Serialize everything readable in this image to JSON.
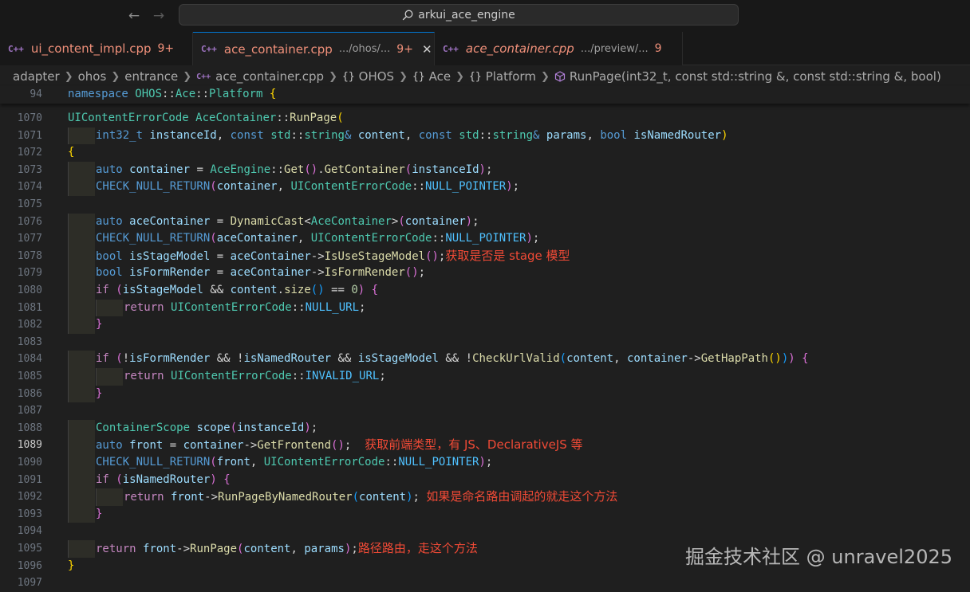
{
  "titlebar": {
    "back_icon": "arrow-left-icon",
    "forward_icon": "arrow-right-icon",
    "search_text": "arkui_ace_engine"
  },
  "tabs": [
    {
      "icon": "C++",
      "name": "ui_content_impl.cpp",
      "path": "",
      "badge": "9+",
      "active": false,
      "italic": false,
      "close": ""
    },
    {
      "icon": "C++",
      "name": "ace_container.cpp",
      "path": ".../ohos/...",
      "badge": "9+",
      "active": true,
      "italic": false,
      "close": "✕"
    },
    {
      "icon": "C++",
      "name": "ace_container.cpp",
      "path": ".../preview/...",
      "badge": "9",
      "active": false,
      "italic": true,
      "close": ""
    }
  ],
  "breadcrumb": {
    "folders": [
      "adapter",
      "ohos",
      "entrance"
    ],
    "file": "ace_container.cpp",
    "symbols": [
      "OHOS",
      "Ace",
      "Platform"
    ],
    "method": "RunPage(int32_t, const std::string &, const std::string &, bool)"
  },
  "editor": {
    "current_line": "1089",
    "lines": [
      {
        "n": "94",
        "sticky": true,
        "indent": 0,
        "t": [
          [
            "kw",
            "namespace "
          ],
          [
            "type",
            "OHOS"
          ],
          [
            "p",
            "::"
          ],
          [
            "type",
            "Ace"
          ],
          [
            "p",
            "::"
          ],
          [
            "type",
            "Platform"
          ],
          [
            "p",
            " "
          ],
          [
            "b1",
            "{"
          ]
        ]
      },
      {
        "n": "1070",
        "indent": 0,
        "t": [
          [
            "type",
            "UIContentErrorCode"
          ],
          [
            "p",
            " "
          ],
          [
            "type",
            "AceContainer"
          ],
          [
            "p",
            "::"
          ],
          [
            "fn",
            "RunPage"
          ],
          [
            "b1",
            "("
          ]
        ]
      },
      {
        "n": "1071",
        "indent": 1,
        "t": [
          [
            "kw",
            "int32_t"
          ],
          [
            "p",
            " "
          ],
          [
            "var",
            "instanceId"
          ],
          [
            "p",
            ", "
          ],
          [
            "kw",
            "const"
          ],
          [
            "p",
            " "
          ],
          [
            "type",
            "std"
          ],
          [
            "p",
            "::"
          ],
          [
            "type",
            "string"
          ],
          [
            "kw",
            "&"
          ],
          [
            "p",
            " "
          ],
          [
            "var",
            "content"
          ],
          [
            "p",
            ", "
          ],
          [
            "kw",
            "const"
          ],
          [
            "p",
            " "
          ],
          [
            "type",
            "std"
          ],
          [
            "p",
            "::"
          ],
          [
            "type",
            "string"
          ],
          [
            "kw",
            "&"
          ],
          [
            "p",
            " "
          ],
          [
            "var",
            "params"
          ],
          [
            "p",
            ", "
          ],
          [
            "kw",
            "bool"
          ],
          [
            "p",
            " "
          ],
          [
            "var",
            "isNamedRouter"
          ],
          [
            "b1",
            ")"
          ]
        ]
      },
      {
        "n": "1072",
        "indent": 0,
        "t": [
          [
            "b1",
            "{"
          ]
        ]
      },
      {
        "n": "1073",
        "indent": 1,
        "t": [
          [
            "kw",
            "auto"
          ],
          [
            "p",
            " "
          ],
          [
            "var",
            "container"
          ],
          [
            "p",
            " = "
          ],
          [
            "type",
            "AceEngine"
          ],
          [
            "p",
            "::"
          ],
          [
            "fn",
            "Get"
          ],
          [
            "b2",
            "()"
          ],
          [
            "p",
            "."
          ],
          [
            "fn",
            "GetContainer"
          ],
          [
            "b2",
            "("
          ],
          [
            "var",
            "instanceId"
          ],
          [
            "b2",
            ")"
          ],
          [
            "p",
            ";"
          ]
        ]
      },
      {
        "n": "1074",
        "indent": 1,
        "t": [
          [
            "macro",
            "CHECK_NULL_RETURN"
          ],
          [
            "b2",
            "("
          ],
          [
            "var",
            "container"
          ],
          [
            "p",
            ", "
          ],
          [
            "type",
            "UIContentErrorCode"
          ],
          [
            "p",
            "::"
          ],
          [
            "const",
            "NULL_POINTER"
          ],
          [
            "b2",
            ")"
          ],
          [
            "p",
            ";"
          ]
        ]
      },
      {
        "n": "1075",
        "indent": 0,
        "t": []
      },
      {
        "n": "1076",
        "indent": 1,
        "t": [
          [
            "kw",
            "auto"
          ],
          [
            "p",
            " "
          ],
          [
            "var",
            "aceContainer"
          ],
          [
            "p",
            " = "
          ],
          [
            "fn",
            "DynamicCast"
          ],
          [
            "p",
            "<"
          ],
          [
            "type",
            "AceContainer"
          ],
          [
            "p",
            ">"
          ],
          [
            "b2",
            "("
          ],
          [
            "var",
            "container"
          ],
          [
            "b2",
            ")"
          ],
          [
            "p",
            ";"
          ]
        ]
      },
      {
        "n": "1077",
        "indent": 1,
        "t": [
          [
            "macro",
            "CHECK_NULL_RETURN"
          ],
          [
            "b2",
            "("
          ],
          [
            "var",
            "aceContainer"
          ],
          [
            "p",
            ", "
          ],
          [
            "type",
            "UIContentErrorCode"
          ],
          [
            "p",
            "::"
          ],
          [
            "const",
            "NULL_POINTER"
          ],
          [
            "b2",
            ")"
          ],
          [
            "p",
            ";"
          ]
        ]
      },
      {
        "n": "1078",
        "indent": 1,
        "t": [
          [
            "kw",
            "bool"
          ],
          [
            "p",
            " "
          ],
          [
            "var",
            "isStageModel"
          ],
          [
            "p",
            " = "
          ],
          [
            "var",
            "aceContainer"
          ],
          [
            "p",
            "->"
          ],
          [
            "fn",
            "IsUseStageModel"
          ],
          [
            "b2",
            "()"
          ],
          [
            "p",
            ";"
          ]
        ],
        "note": "获取是否是 stage 模型",
        "note_gap": ""
      },
      {
        "n": "1079",
        "indent": 1,
        "t": [
          [
            "kw",
            "bool"
          ],
          [
            "p",
            " "
          ],
          [
            "var",
            "isFormRender"
          ],
          [
            "p",
            " = "
          ],
          [
            "var",
            "aceContainer"
          ],
          [
            "p",
            "->"
          ],
          [
            "fn",
            "IsFormRender"
          ],
          [
            "b2",
            "()"
          ],
          [
            "p",
            ";"
          ]
        ]
      },
      {
        "n": "1080",
        "indent": 1,
        "t": [
          [
            "ctrl",
            "if"
          ],
          [
            "p",
            " "
          ],
          [
            "b2",
            "("
          ],
          [
            "var",
            "isStageModel"
          ],
          [
            "p",
            " && "
          ],
          [
            "var",
            "content"
          ],
          [
            "p",
            "."
          ],
          [
            "fn",
            "size"
          ],
          [
            "b3",
            "()"
          ],
          [
            "p",
            " == "
          ],
          [
            "num",
            "0"
          ],
          [
            "b2",
            ")"
          ],
          [
            "p",
            " "
          ],
          [
            "b2",
            "{"
          ]
        ]
      },
      {
        "n": "1081",
        "indent": 2,
        "t": [
          [
            "ctrl",
            "return"
          ],
          [
            "p",
            " "
          ],
          [
            "type",
            "UIContentErrorCode"
          ],
          [
            "p",
            "::"
          ],
          [
            "const",
            "NULL_URL"
          ],
          [
            "p",
            ";"
          ]
        ]
      },
      {
        "n": "1082",
        "indent": 1,
        "t": [
          [
            "b2",
            "}"
          ]
        ]
      },
      {
        "n": "1083",
        "indent": 0,
        "t": []
      },
      {
        "n": "1084",
        "indent": 1,
        "t": [
          [
            "ctrl",
            "if"
          ],
          [
            "p",
            " "
          ],
          [
            "b2",
            "("
          ],
          [
            "p",
            "!"
          ],
          [
            "var",
            "isFormRender"
          ],
          [
            "p",
            " && !"
          ],
          [
            "var",
            "isNamedRouter"
          ],
          [
            "p",
            " && "
          ],
          [
            "var",
            "isStageModel"
          ],
          [
            "p",
            " && !"
          ],
          [
            "fn",
            "CheckUrlValid"
          ],
          [
            "b3",
            "("
          ],
          [
            "var",
            "content"
          ],
          [
            "p",
            ", "
          ],
          [
            "var",
            "container"
          ],
          [
            "p",
            "->"
          ],
          [
            "fn",
            "GetHapPath"
          ],
          [
            "b1",
            "()"
          ],
          [
            "b3",
            ")"
          ],
          [
            "b2",
            ")"
          ],
          [
            "p",
            " "
          ],
          [
            "b2",
            "{"
          ]
        ]
      },
      {
        "n": "1085",
        "indent": 2,
        "t": [
          [
            "ctrl",
            "return"
          ],
          [
            "p",
            " "
          ],
          [
            "type",
            "UIContentErrorCode"
          ],
          [
            "p",
            "::"
          ],
          [
            "const",
            "INVALID_URL"
          ],
          [
            "p",
            ";"
          ]
        ]
      },
      {
        "n": "1086",
        "indent": 1,
        "t": [
          [
            "b2",
            "}"
          ]
        ]
      },
      {
        "n": "1087",
        "indent": 0,
        "t": []
      },
      {
        "n": "1088",
        "indent": 1,
        "t": [
          [
            "type",
            "ContainerScope"
          ],
          [
            "p",
            " "
          ],
          [
            "var",
            "scope"
          ],
          [
            "b2",
            "("
          ],
          [
            "var",
            "instanceId"
          ],
          [
            "b2",
            ")"
          ],
          [
            "p",
            ";"
          ]
        ]
      },
      {
        "n": "1089",
        "indent": 1,
        "t": [
          [
            "kw",
            "auto"
          ],
          [
            "p",
            " "
          ],
          [
            "var",
            "front"
          ],
          [
            "p",
            " = "
          ],
          [
            "var",
            "container"
          ],
          [
            "p",
            "->"
          ],
          [
            "fn",
            "GetFrontend"
          ],
          [
            "b2",
            "()"
          ],
          [
            "p",
            ";"
          ]
        ],
        "note": "获取前端类型，有 JS、DeclarativeJS 等",
        "note_gap": "  "
      },
      {
        "n": "1090",
        "indent": 1,
        "t": [
          [
            "macro",
            "CHECK_NULL_RETURN"
          ],
          [
            "b2",
            "("
          ],
          [
            "var",
            "front"
          ],
          [
            "p",
            ", "
          ],
          [
            "type",
            "UIContentErrorCode"
          ],
          [
            "p",
            "::"
          ],
          [
            "const",
            "NULL_POINTER"
          ],
          [
            "b2",
            ")"
          ],
          [
            "p",
            ";"
          ]
        ]
      },
      {
        "n": "1091",
        "indent": 1,
        "t": [
          [
            "ctrl",
            "if"
          ],
          [
            "p",
            " "
          ],
          [
            "b2",
            "("
          ],
          [
            "var",
            "isNamedRouter"
          ],
          [
            "b2",
            ")"
          ],
          [
            "p",
            " "
          ],
          [
            "b2",
            "{"
          ]
        ]
      },
      {
        "n": "1092",
        "indent": 2,
        "t": [
          [
            "ctrl",
            "return"
          ],
          [
            "p",
            " "
          ],
          [
            "var",
            "front"
          ],
          [
            "p",
            "->"
          ],
          [
            "fn",
            "RunPageByNamedRouter"
          ],
          [
            "b3",
            "("
          ],
          [
            "var",
            "content"
          ],
          [
            "b3",
            ")"
          ],
          [
            "p",
            ";"
          ]
        ],
        "note": "如果是命名路由调起的就走这个方法",
        "note_gap": " "
      },
      {
        "n": "1093",
        "indent": 1,
        "t": [
          [
            "b2",
            "}"
          ]
        ]
      },
      {
        "n": "1094",
        "indent": 0,
        "t": []
      },
      {
        "n": "1095",
        "indent": 1,
        "t": [
          [
            "ctrl",
            "return"
          ],
          [
            "p",
            " "
          ],
          [
            "var",
            "front"
          ],
          [
            "p",
            "->"
          ],
          [
            "fn",
            "RunPage"
          ],
          [
            "b2",
            "("
          ],
          [
            "var",
            "content"
          ],
          [
            "p",
            ", "
          ],
          [
            "var",
            "params"
          ],
          [
            "b2",
            ")"
          ],
          [
            "p",
            ";"
          ]
        ],
        "note": "路径路由，走这个方法",
        "note_gap": ""
      },
      {
        "n": "1096",
        "indent": 0,
        "t": [
          [
            "b1",
            "}"
          ]
        ]
      },
      {
        "n": "1097",
        "indent": 0,
        "t": []
      }
    ]
  },
  "watermark": "掘金技术社区 @ unravel2025",
  "colors": {
    "background": "#1f1f1f",
    "accent_tab_border": "#0078d4",
    "annotation_red": "#f04a36",
    "tab_modified": "#f0907a"
  }
}
